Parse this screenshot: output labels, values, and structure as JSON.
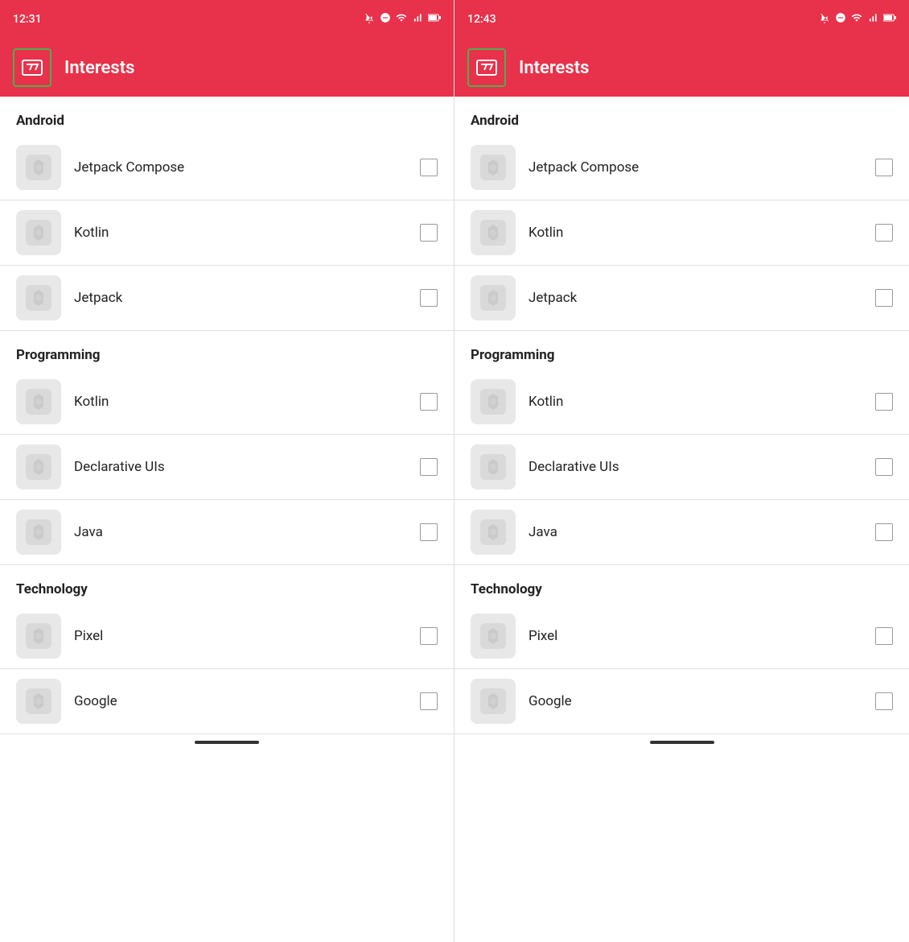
{
  "panels": [
    {
      "id": "left",
      "statusBar": {
        "time": "12:31",
        "icons": [
          "📵",
          "⊖",
          "▲",
          "▌"
        ]
      },
      "appBar": {
        "title": "Interests"
      },
      "sections": [
        {
          "header": "Android",
          "items": [
            {
              "label": "Jetpack Compose"
            },
            {
              "label": "Kotlin"
            },
            {
              "label": "Jetpack"
            }
          ]
        },
        {
          "header": "Programming",
          "items": [
            {
              "label": "Kotlin"
            },
            {
              "label": "Declarative UIs"
            },
            {
              "label": "Java"
            }
          ]
        },
        {
          "header": "Technology",
          "items": [
            {
              "label": "Pixel"
            },
            {
              "label": "Google"
            }
          ]
        }
      ]
    },
    {
      "id": "right",
      "statusBar": {
        "time": "12:43",
        "icons": [
          "📵",
          "⊖",
          "▲",
          "▌"
        ]
      },
      "appBar": {
        "title": "Interests"
      },
      "sections": [
        {
          "header": "Android",
          "items": [
            {
              "label": "Jetpack Compose"
            },
            {
              "label": "Kotlin"
            },
            {
              "label": "Jetpack"
            }
          ]
        },
        {
          "header": "Programming",
          "items": [
            {
              "label": "Kotlin"
            },
            {
              "label": "Declarative UIs"
            },
            {
              "label": "Java"
            }
          ]
        },
        {
          "header": "Technology",
          "items": [
            {
              "label": "Pixel"
            },
            {
              "label": "Google"
            }
          ]
        }
      ]
    }
  ]
}
